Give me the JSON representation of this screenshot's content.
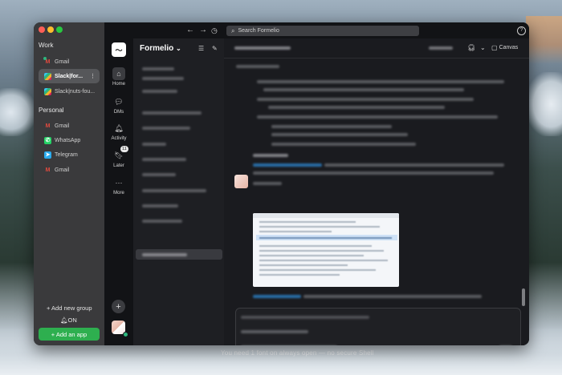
{
  "desktop": {
    "caption": "You need 1 font on always open — no secure Shell"
  },
  "switcher": {
    "groups": [
      {
        "title": "Work",
        "items": [
          {
            "label": "Gmail",
            "icon": "gmail-icon",
            "active": false
          },
          {
            "label": "Slack|for...",
            "icon": "slack-icon",
            "active": true
          },
          {
            "label": "Slack|nuts-fou...",
            "icon": "slack-icon",
            "active": false
          }
        ]
      },
      {
        "title": "Personal",
        "items": [
          {
            "label": "Gmail",
            "icon": "gmail-icon",
            "active": false
          },
          {
            "label": "WhatsApp",
            "icon": "whatsapp-icon",
            "active": false
          },
          {
            "label": "Telegram",
            "icon": "telegram-icon",
            "active": false
          },
          {
            "label": "Gmail",
            "icon": "gmail-icon",
            "active": false
          }
        ]
      }
    ],
    "add_group": "+ Add new group",
    "notifications": "ON",
    "add_app": "+ Add an app"
  },
  "topbar": {
    "search_placeholder": "Search Formelio"
  },
  "rail": {
    "items": [
      {
        "label": "Home",
        "icon": "home-icon",
        "active": true
      },
      {
        "label": "DMs",
        "icon": "dms-icon"
      },
      {
        "label": "Activity",
        "icon": "bell-icon"
      },
      {
        "label": "Later",
        "icon": "bookmark-icon",
        "badge": "11"
      },
      {
        "label": "More",
        "icon": "more-icon"
      }
    ]
  },
  "sidebar": {
    "workspace_name": "Formelio",
    "workspace_chevron": "⌄"
  },
  "main": {
    "canvas_label": "Canvas"
  }
}
